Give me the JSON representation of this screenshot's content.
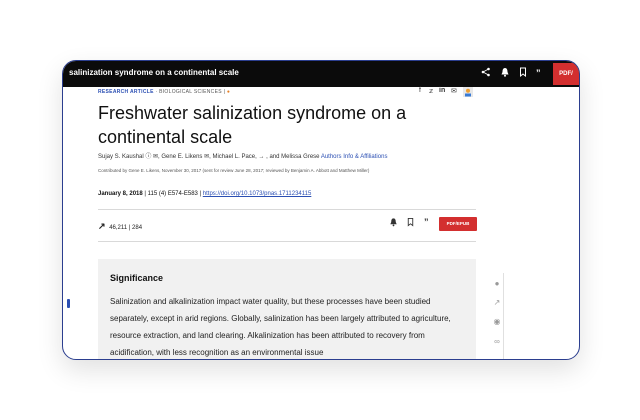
{
  "topbar": {
    "title": "salinization syndrome on a continental scale",
    "icons": [
      "share-icon",
      "bell-icon",
      "bookmark-icon",
      "quote-icon"
    ],
    "pdf_label": "PDF/"
  },
  "article": {
    "kicker_type": "RESEARCH ARTICLE",
    "kicker_section": "BIOLOGICAL SCIENCES",
    "kicker_sep": "|",
    "title": "Freshwater salinization syndrome on a continental scale",
    "authors_text": "Sujay S. Kaushal ⓘ ✉, Gene E. Likens ✉, Michael L. Pace, → , and Melissa Grese",
    "authors_link": "Authors Info & Affiliations",
    "edited_by": "Contributed by Gene E. Likens, November 30, 2017 (sent for review June 28, 2017; reviewed by Benjamin A. Abbott and Matthew Miller)",
    "date": "January 8, 2018",
    "issue": "115 (4) E574-E583",
    "doi": "https://doi.org/10.1073/pnas.1711234115",
    "views": "46,211",
    "citations": "284",
    "pdf_epub_label": "PDF/EPUB"
  },
  "significance": {
    "heading": "Significance",
    "text": "Salinization and alkalinization impact water quality, but these processes have been studied separately, except in arid regions. Globally, salinization has been largely attributed to agriculture, resource extraction, and land clearing. Alkalinization has been attributed to recovery from acidification, with less recognition as an environmental issue"
  },
  "colors": {
    "accent": "#2b4fb3",
    "pdf": "#d32f2f",
    "bar": "#0b0b0b"
  }
}
